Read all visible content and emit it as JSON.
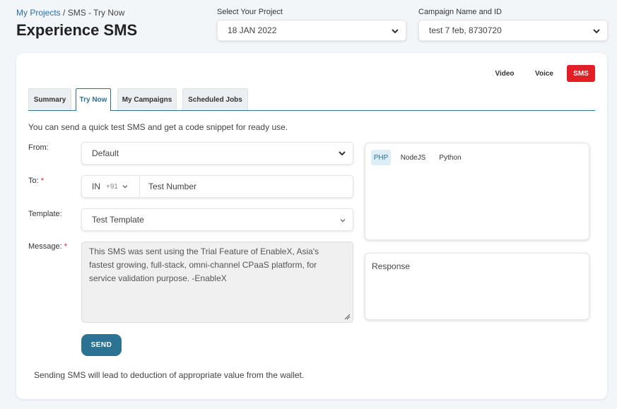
{
  "breadcrumb": {
    "link": "My Projects",
    "separator": " / ",
    "current": "SMS - Try Now"
  },
  "page_title": "Experience SMS",
  "project_select": {
    "label": "Select Your Project",
    "value": "18 JAN 2022"
  },
  "campaign_select": {
    "label": "Campaign Name and ID",
    "value": "test 7 feb, 8730720"
  },
  "channels": [
    {
      "label": "Video",
      "active": false
    },
    {
      "label": "Voice",
      "active": false
    },
    {
      "label": "SMS",
      "active": true
    }
  ],
  "tabs": [
    {
      "label": "Summary",
      "active": false
    },
    {
      "label": "Try Now",
      "active": true
    },
    {
      "label": "My Campaigns",
      "active": false
    },
    {
      "label": "Scheduled Jobs",
      "active": false
    }
  ],
  "intro_text": "You can send a quick test SMS and get a code snippet for ready use.",
  "form": {
    "from_label": "From:",
    "from_value": "Default",
    "to_label": "To:",
    "required_mark": "*",
    "country_code": "IN",
    "dial_code": "+91",
    "number_placeholder": "Test Number",
    "template_label": "Template:",
    "template_value": "Test Template",
    "message_label": "Message:",
    "message_value": "This SMS was sent using the Trial Feature of  EnableX, Asia's fastest growing, full-stack, omni-channel CPaaS platform, for service validation purpose. -EnableX",
    "send_label": "SEND"
  },
  "footnote": "Sending SMS will lead to deduction of appropriate value from the wallet.",
  "code_panel": {
    "languages": [
      {
        "label": "PHP",
        "active": true
      },
      {
        "label": "NodeJS",
        "active": false
      },
      {
        "label": "Python",
        "active": false
      }
    ]
  },
  "response_panel": {
    "label": "Response"
  },
  "colors": {
    "accent": "#2b7293",
    "danger": "#e21e26",
    "link": "#2c6ca8"
  }
}
